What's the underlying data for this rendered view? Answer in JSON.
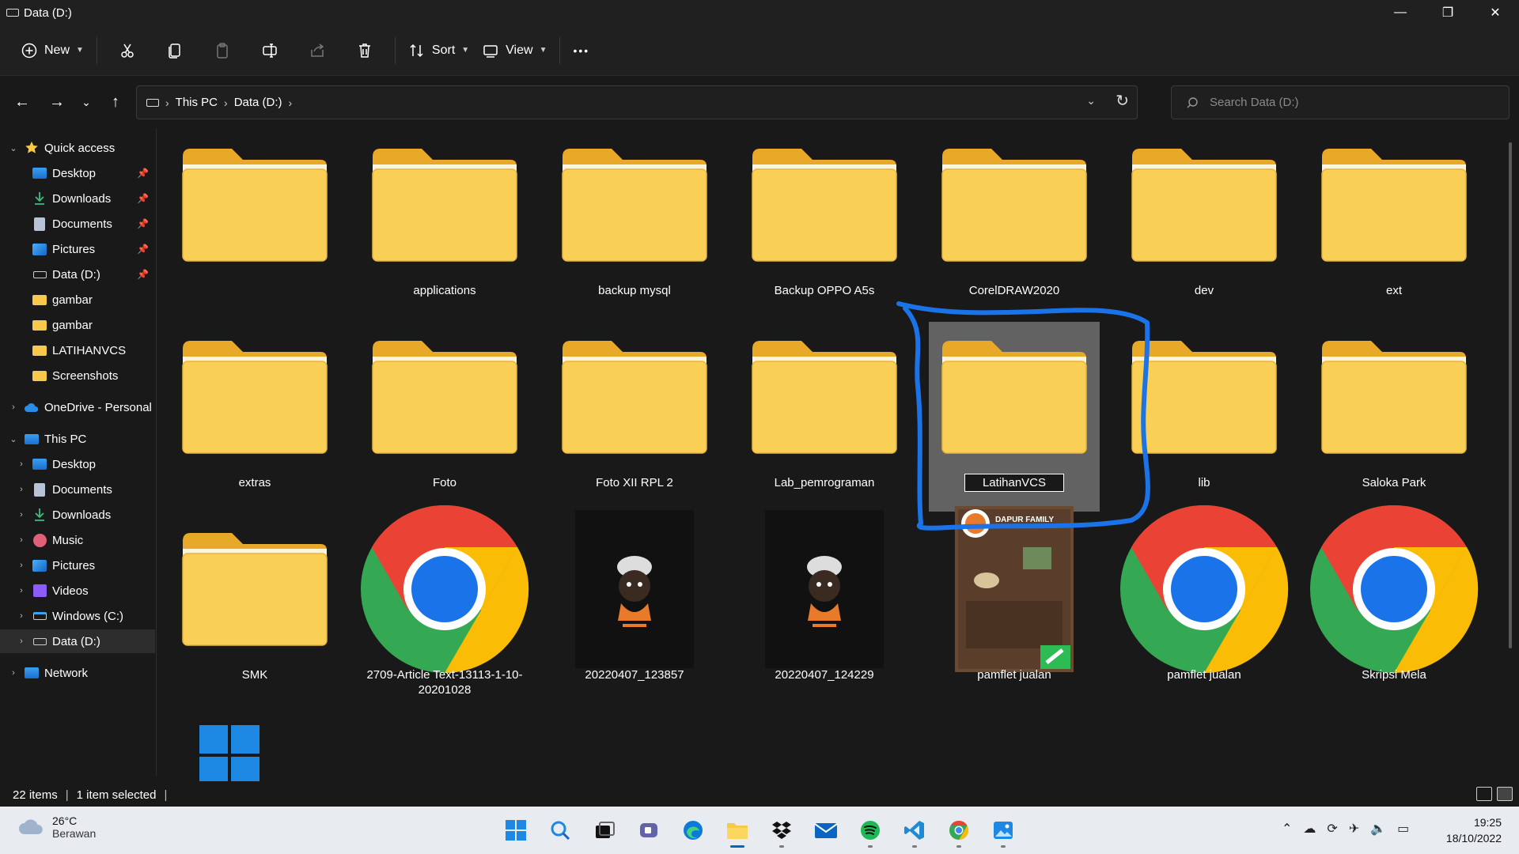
{
  "window": {
    "title": "Data (D:)",
    "minimize": "—",
    "restore": "❐",
    "close": "✕"
  },
  "toolbar": {
    "new_label": "New",
    "sort_label": "Sort",
    "view_label": "View",
    "more_label": "•••"
  },
  "address": {
    "crumbs": [
      "This PC",
      "Data (D:)"
    ],
    "search_placeholder": "Search Data (D:)"
  },
  "sidebar": {
    "quick_access": "Quick access",
    "quick_items": [
      "Desktop",
      "Downloads",
      "Documents",
      "Pictures",
      "Data (D:)",
      "gambar",
      "gambar",
      "LATIHANVCS",
      "Screenshots"
    ],
    "onedrive": "OneDrive - Personal",
    "this_pc": "This PC",
    "pc_items": [
      "Desktop",
      "Documents",
      "Downloads",
      "Music",
      "Pictures",
      "Videos",
      "Windows (C:)",
      "Data (D:)"
    ],
    "network": "Network"
  },
  "files": [
    {
      "name": "",
      "type": "folder"
    },
    {
      "name": "applications",
      "type": "folder"
    },
    {
      "name": "backup mysql",
      "type": "folder"
    },
    {
      "name": "Backup OPPO A5s",
      "type": "folder"
    },
    {
      "name": "CorelDRAW2020",
      "type": "folder"
    },
    {
      "name": "dev",
      "type": "folder"
    },
    {
      "name": "ext",
      "type": "folder"
    },
    {
      "name": "extras",
      "type": "folder"
    },
    {
      "name": "Foto",
      "type": "folder"
    },
    {
      "name": "Foto XII RPL 2",
      "type": "folder"
    },
    {
      "name": "Lab_pemrograman",
      "type": "folder"
    },
    {
      "name": "LatihanVCS",
      "type": "folder",
      "selected": true
    },
    {
      "name": "lib",
      "type": "folder"
    },
    {
      "name": "Saloka Park",
      "type": "folder"
    },
    {
      "name": "SMK",
      "type": "folder"
    },
    {
      "name": "2709-Article Text-13113-1-10-20201028",
      "type": "chrome"
    },
    {
      "name": "20220407_123857",
      "type": "image-chef"
    },
    {
      "name": "20220407_124229",
      "type": "image-chef"
    },
    {
      "name": "pamflet jualan",
      "type": "image-flyer"
    },
    {
      "name": "pamflet jualan",
      "type": "chrome"
    },
    {
      "name": "Skripsi Mela",
      "type": "chrome"
    },
    {
      "name": "",
      "type": "windows-logo"
    }
  ],
  "flyer_text": "DAPUR FAMILY",
  "status": {
    "items": "22 items",
    "selected": "1 item selected"
  },
  "taskbar": {
    "temp": "26°C",
    "weather": "Berawan",
    "time": "19:25",
    "date": "18/10/2022"
  },
  "colors": {
    "folder": "#f7c948",
    "annotation": "#1a73e8",
    "selection": "#626262"
  }
}
